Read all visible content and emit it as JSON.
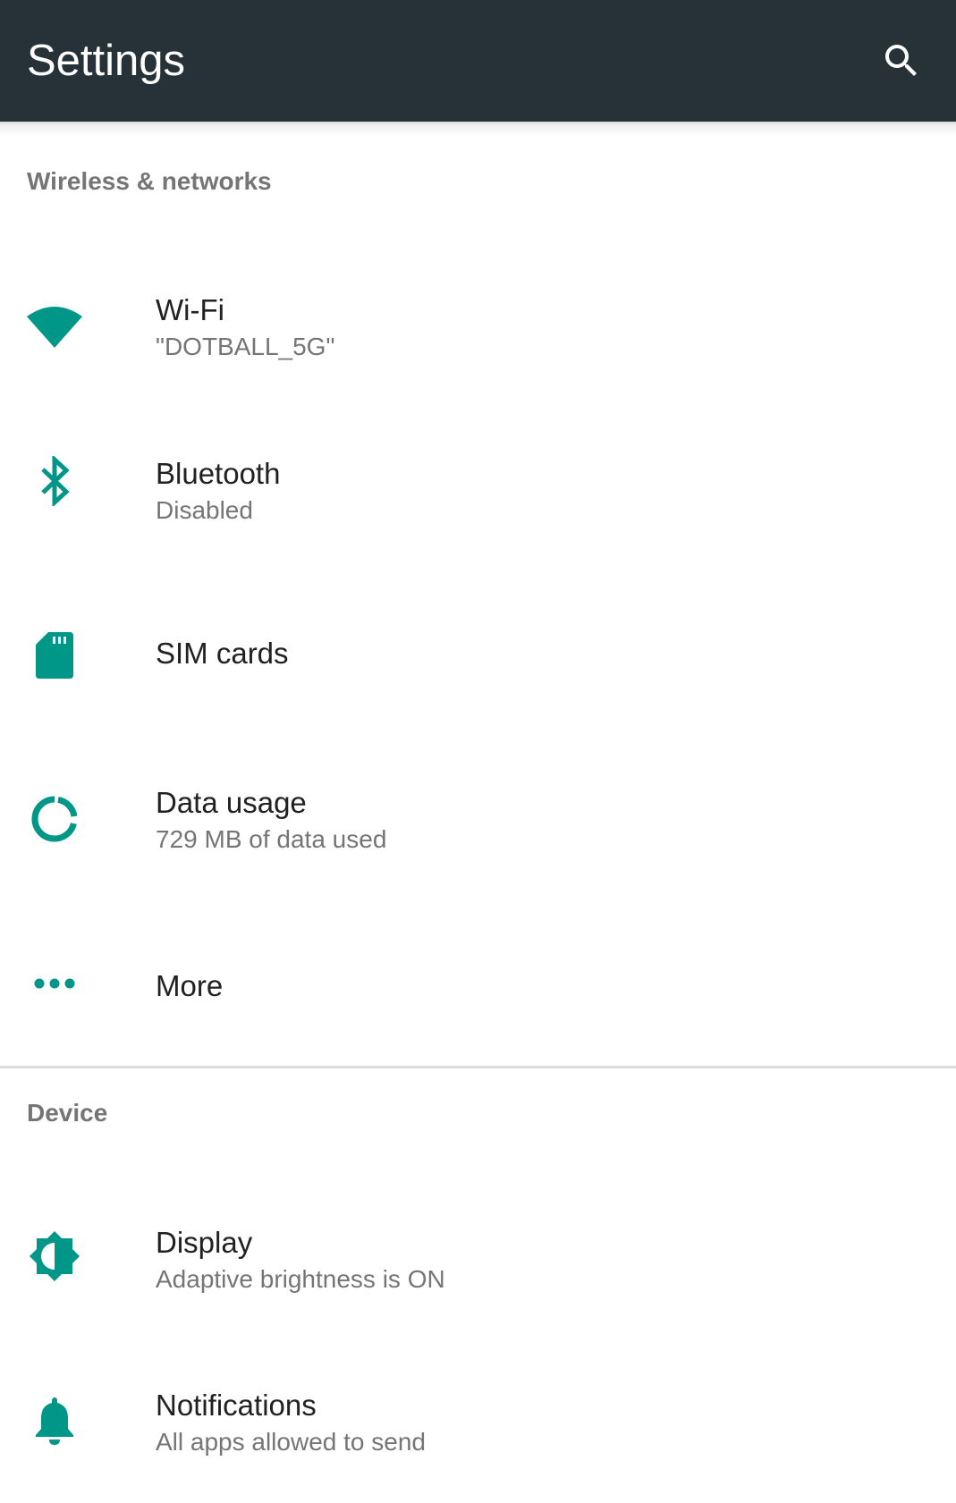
{
  "colors": {
    "toolbar": "#263238",
    "accent": "#009688",
    "primary_text": "#212121",
    "secondary_text": "#757575",
    "divider": "#dcdcdc"
  },
  "toolbar": {
    "title": "Settings",
    "search_icon": "search-icon"
  },
  "sections": {
    "wireless": {
      "header": "Wireless & networks",
      "wifi": {
        "icon": "wifi-icon",
        "title": "Wi-Fi",
        "summary": "\"DOTBALL_5G\""
      },
      "bluetooth": {
        "icon": "bluetooth-icon",
        "title": "Bluetooth",
        "summary": "Disabled"
      },
      "sim": {
        "icon": "sim-card-icon",
        "title": "SIM cards"
      },
      "data": {
        "icon": "data-usage-icon",
        "title": "Data usage",
        "summary": "729 MB of data used"
      },
      "more": {
        "icon": "more-horiz-icon",
        "title": "More"
      }
    },
    "device": {
      "header": "Device",
      "display": {
        "icon": "brightness-icon",
        "title": "Display",
        "summary": "Adaptive brightness is ON"
      },
      "notifications": {
        "icon": "bell-icon",
        "title": "Notifications",
        "summary": "All apps allowed to send"
      }
    }
  }
}
